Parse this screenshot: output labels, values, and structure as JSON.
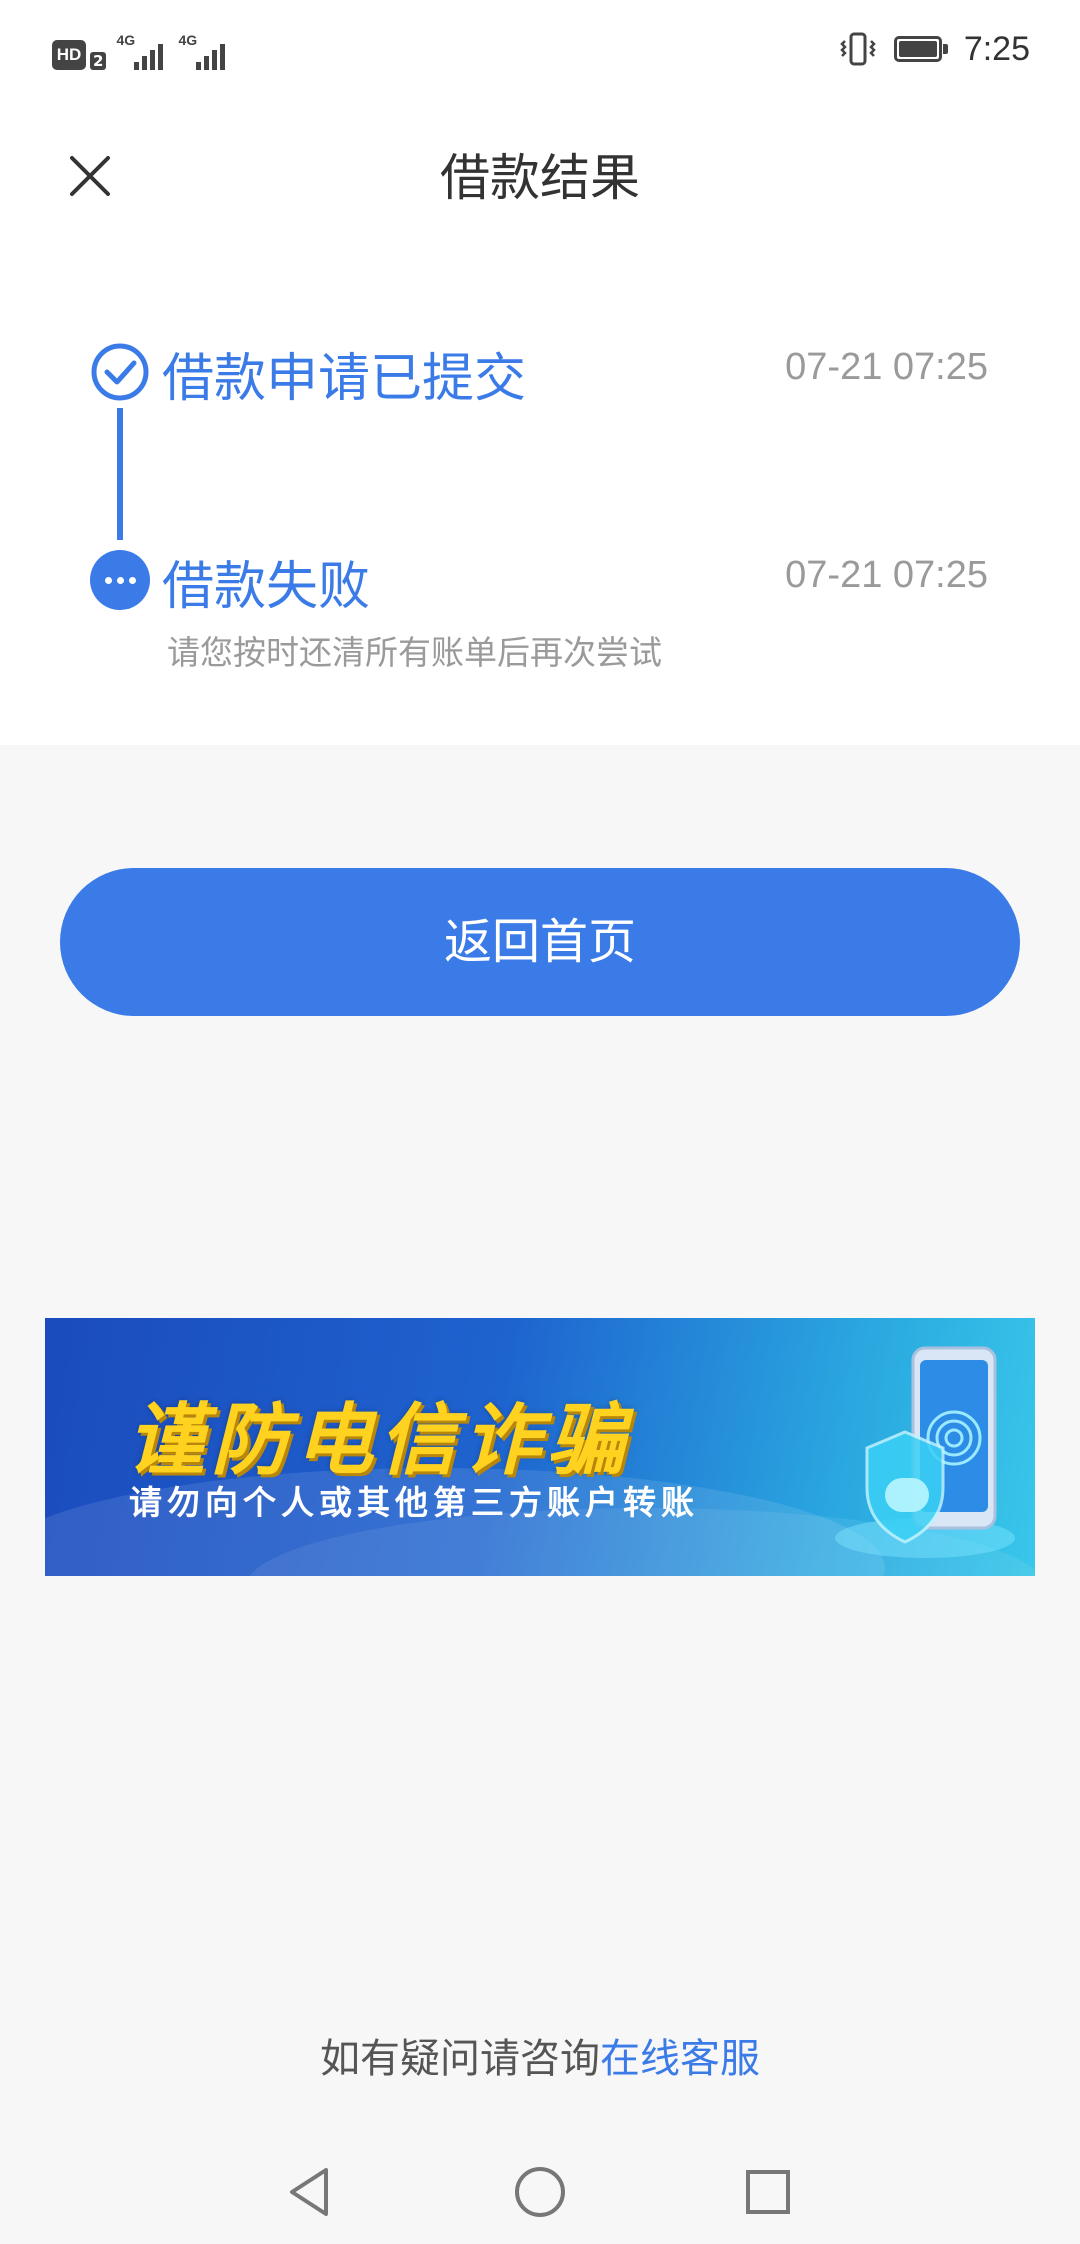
{
  "status_bar": {
    "hd_label": "HD",
    "hd_sub": "2",
    "network_1": "4G",
    "network_2": "4G",
    "time": "7:25"
  },
  "header": {
    "title": "借款结果",
    "close_icon": "close-icon"
  },
  "timeline": {
    "steps": [
      {
        "title": "借款申请已提交",
        "time": "07-21 07:25",
        "icon": "check-circle-icon",
        "description": ""
      },
      {
        "title": "借款失败",
        "time": "07-21 07:25",
        "icon": "more-dots-icon",
        "description": "请您按时还清所有账单后再次尝试"
      }
    ]
  },
  "actions": {
    "home_label": "返回首页"
  },
  "banner": {
    "title": "谨防电信诈骗",
    "subtitle": "请勿向个人或其他第三方账户转账"
  },
  "help": {
    "prefix": "如有疑问请咨询",
    "link": "在线客服"
  },
  "colors": {
    "accent": "#3a7be8",
    "muted": "#9a9a9a",
    "background": "#f7f7f8"
  }
}
